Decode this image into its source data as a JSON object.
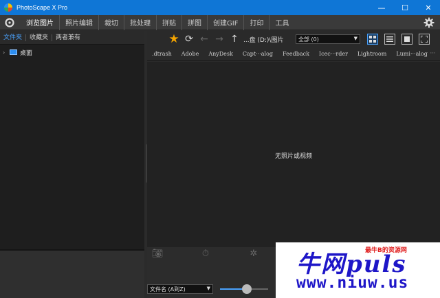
{
  "window": {
    "title": "PhotoScape X Pro",
    "minimize": "—",
    "maximize": "☐",
    "close": "✕"
  },
  "menu": {
    "items": [
      "浏览图片",
      "照片编辑",
      "裁切",
      "批处理",
      "拼贴",
      "拼图",
      "创建GIF",
      "打印",
      "工具"
    ],
    "active_index": 0
  },
  "left": {
    "tabs": [
      "文件夹",
      "收藏夹",
      "两者兼有"
    ],
    "tree": [
      {
        "label": "桌面",
        "expand": "›"
      }
    ]
  },
  "toolbar": {
    "path": "...盘 (D:)\\图片",
    "filter_value": "全部 (0)",
    "filter_arrow": "▼"
  },
  "folders": [
    ".dtrash",
    "Adobe",
    "AnyDesk",
    "Capt···alog",
    "Feedback",
    "Icec···rder",
    "Lightroom",
    "Lumi···alog"
  ],
  "folders_more": "···",
  "content": {
    "empty_message": "无照片或视频"
  },
  "bottom": {
    "sort_value": "文件名 (A到Z)",
    "sort_arrow": "▼",
    "zoom_fraction": 0.55
  },
  "watermark": {
    "text": "牛网puls",
    "tagline": "最牛B的资源网",
    "url": "www.niuw.us"
  },
  "colors": {
    "titlebar": "#0f76d6",
    "accent": "#4aa3ff",
    "star": "#f5a500"
  }
}
